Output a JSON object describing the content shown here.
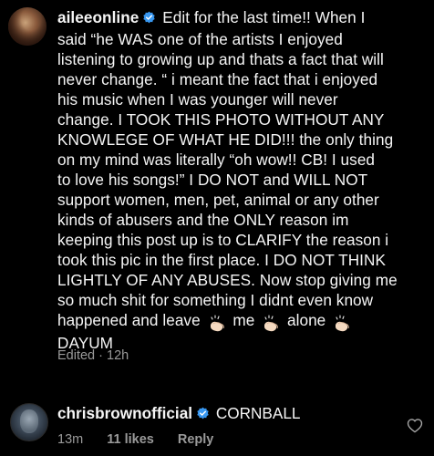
{
  "comments": [
    {
      "username": "aileeonline",
      "verified": true,
      "avatar_icon": "avatar-photo",
      "lines": [
        "Edit for the last time!! When I",
        "said “he WAS one of the artists I enjoyed",
        "listening to growing up and thats a fact that will",
        "never change. “ i meant the fact that i enjoyed",
        "his music when I was younger will never",
        "change. I TOOK THIS PHOTO WITHOUT ANY",
        "KNOWLEGE OF WHAT HE DID!!! the only thing",
        "on my mind was literally “oh wow!! CB! I used",
        "to love his songs!” I DO NOT and WILL NOT",
        "support women, men, pet, animal or any other",
        "kinds of abusers and the ONLY reason im",
        "keeping this post up is to CLARIFY the reason i",
        "took this pic in the first place. I DO NOT THINK",
        "LIGHTLY OF ANY ABUSES. Now stop giving me",
        "so much shit for something I didnt even know"
      ],
      "last_line_parts": [
        "happened  and leave",
        "me",
        "alone"
      ],
      "final_line": "DAYUM",
      "emoji": "clapping-hands",
      "edited_text": "Edited · 12h"
    },
    {
      "username": "chrisbrownofficial",
      "verified": true,
      "avatar_icon": "avatar-photo",
      "text": "CORNBALL",
      "time": "13m",
      "likes": "11 likes",
      "reply_label": "Reply"
    }
  ],
  "colors": {
    "background": "#000000",
    "text": "#f5f5f5",
    "meta": "#9a9a9a",
    "verified_badge": "#3897f0"
  }
}
